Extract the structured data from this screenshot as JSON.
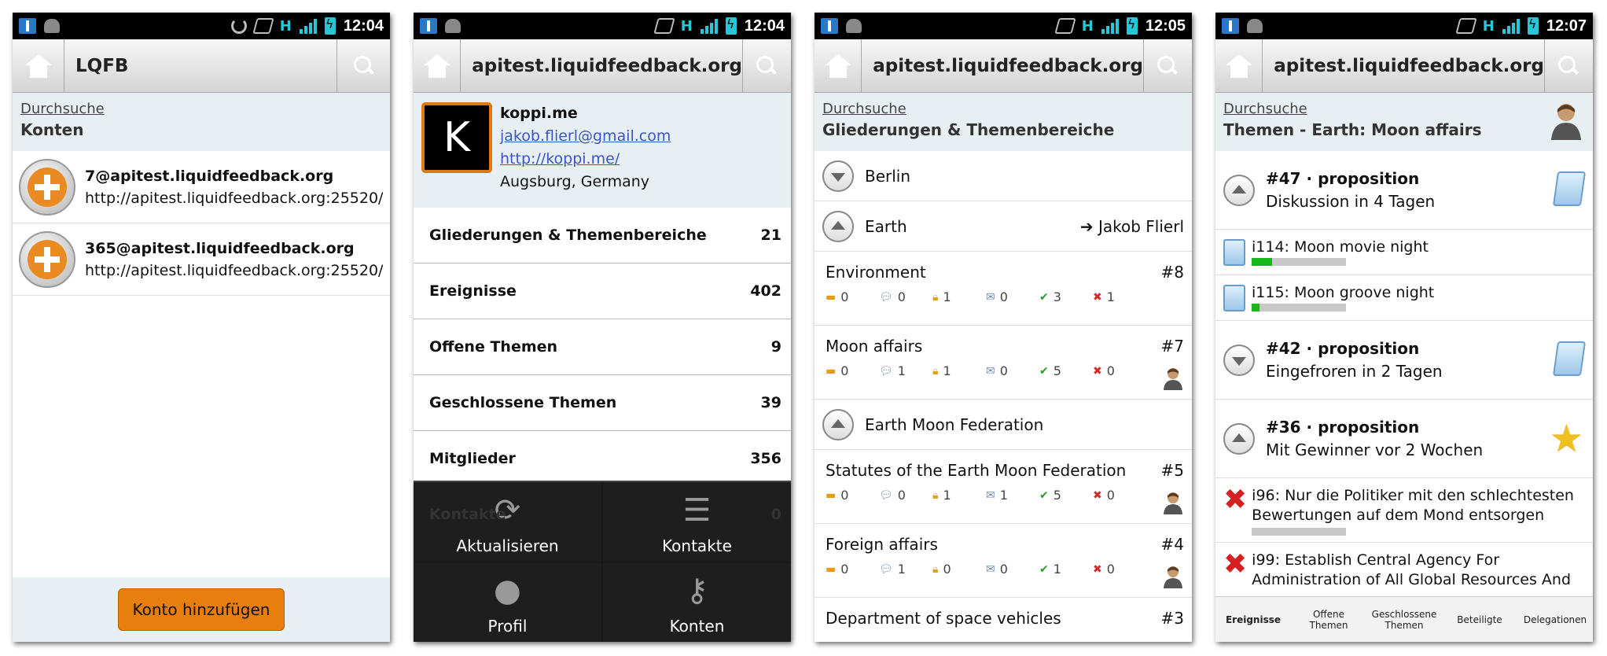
{
  "status": {
    "times": [
      "12:04",
      "12:04",
      "12:05",
      "12:07"
    ]
  },
  "screen1": {
    "title": "LQFB",
    "crumb_link": "Durchsuche",
    "crumb_title": "Konten",
    "accounts": [
      {
        "name": "7@apitest.liquidfeedback.org",
        "url": "http://apitest.liquidfeedback.org:25520/"
      },
      {
        "name": "365@apitest.liquidfeedback.org",
        "url": "http://apitest.liquidfeedback.org:25520/"
      }
    ],
    "add_button": "Konto hinzufügen"
  },
  "screen2": {
    "title": "apitest.liquidfeedback.org",
    "avatar_letter": "K",
    "profile": {
      "name": "koppi.me",
      "email": "jakob.flierl@gmail.com",
      "website": "http://koppi.me/",
      "location": "Augsburg, Germany"
    },
    "stats": [
      {
        "label": "Gliederungen & Themenbereiche",
        "count": "21"
      },
      {
        "label": "Ereignisse",
        "count": "402"
      },
      {
        "label": "Offene Themen",
        "count": "9"
      },
      {
        "label": "Geschlossene Themen",
        "count": "39"
      },
      {
        "label": "Mitglieder",
        "count": "356"
      }
    ],
    "ghost_row": {
      "label": "Kontakte",
      "count": "0"
    },
    "menu": [
      {
        "label": "Aktualisieren",
        "icon": "refresh-icon"
      },
      {
        "label": "Kontakte",
        "icon": "contacts-icon"
      },
      {
        "label": "Profil",
        "icon": "profile-icon"
      },
      {
        "label": "Konten",
        "icon": "accounts-icon"
      }
    ]
  },
  "screen3": {
    "title": "apitest.liquidfeedback.org",
    "crumb_link": "Durchsuche",
    "crumb_title": "Gliederungen & Themenbereiche",
    "berlin": "Berlin",
    "earth": {
      "label": "Earth",
      "delegate": "Jakob Flierl"
    },
    "areas": [
      {
        "name": "Environment",
        "num": "#8",
        "stats": [
          "0",
          "0",
          "1",
          "0",
          "3",
          "1"
        ],
        "avatar": false
      },
      {
        "name": "Moon affairs",
        "num": "#7",
        "stats": [
          "0",
          "1",
          "1",
          "0",
          "5",
          "0"
        ],
        "avatar": true
      }
    ],
    "federation": "Earth Moon Federation",
    "fed_areas": [
      {
        "name": "Statutes of the Earth Moon Federation",
        "num": "#5",
        "stats": [
          "0",
          "0",
          "1",
          "1",
          "5",
          "0"
        ],
        "avatar": true
      },
      {
        "name": "Foreign affairs",
        "num": "#4",
        "stats": [
          "0",
          "1",
          "0",
          "0",
          "1",
          "0"
        ],
        "avatar": true
      }
    ],
    "last_row": {
      "name": "Department of space vehicles",
      "num": "#3"
    }
  },
  "screen4": {
    "title": "apitest.liquidfeedback.org",
    "crumb_link": "Durchsuche",
    "crumb_title": "Themen - Earth: Moon affairs",
    "issue47": {
      "title": "#47 · proposition",
      "state": "Diskussion in 4 Tagen"
    },
    "initiatives": [
      {
        "label": "i114: Moon movie night",
        "fill": 0.22
      },
      {
        "label": "i115: Moon groove night",
        "fill": 0.08
      }
    ],
    "issue42": {
      "title": "#42 · proposition",
      "state": "Eingefroren in 2 Tagen"
    },
    "issue36": {
      "title": "#36 · proposition",
      "state": "Mit Gewinner vor 2 Wochen"
    },
    "rejected": [
      {
        "label": "i96: Nur die Politiker mit den schlechtesten Bewertungen auf dem Mond entsorgen"
      },
      {
        "label": "i99: Establish Central Agency For Administration of All Global Resources And"
      }
    ],
    "tabs": [
      "Ereignisse",
      "Offene Themen",
      "Geschlossene Themen",
      "Beteiligte",
      "Delegationen"
    ]
  }
}
